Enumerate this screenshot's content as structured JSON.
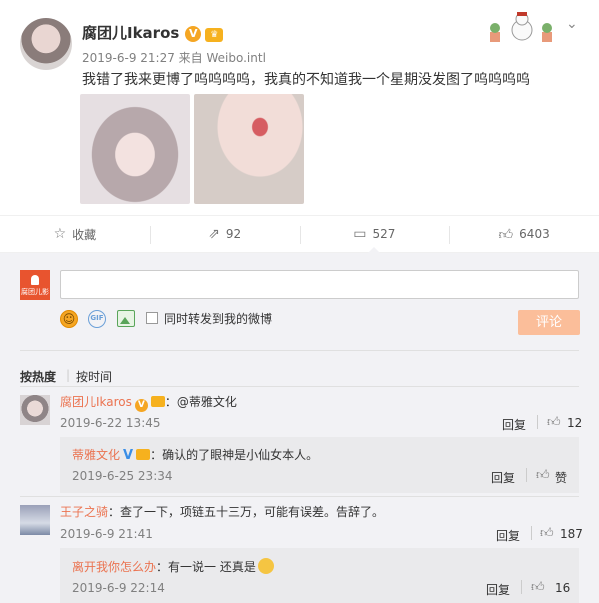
{
  "post": {
    "author": "腐团儿Ikaros",
    "v_badge": "V",
    "meta": "2019-6-9 21:27 来自 Weibo.intl",
    "text": "我错了我来更博了呜呜呜呜，我真的不知道我一个星期没发图了呜呜呜呜"
  },
  "actions": [
    {
      "label": "收藏",
      "icon": "star-icon"
    },
    {
      "label": "92",
      "icon": "share-icon"
    },
    {
      "label": "527",
      "icon": "comment-icon"
    },
    {
      "label": "6403",
      "icon": "like-icon"
    }
  ],
  "composer": {
    "avatar_text": "腐团儿影",
    "input_value": "",
    "repost_label": "同时转发到我的微博",
    "submit_label": "评论"
  },
  "sort": {
    "hot": "按热度",
    "separator": "|",
    "time": "按时间"
  },
  "comments": [
    {
      "name": "腐团儿Ikaros",
      "text": "：@蒂雅文化",
      "time": "2019-6-22 13:45",
      "reply_label": "回复",
      "likes": "12",
      "reply": {
        "name": "蒂雅文化",
        "text": "：确认的了眼神是小仙女本人。",
        "time": "2019-6-25 23:34",
        "reply_label": "回复",
        "likes": "赞"
      }
    },
    {
      "name": "王子之骑",
      "text": "：查了一下，项链五十三万，可能有误差。告辞了。",
      "time": "2019-6-9 21:41",
      "reply_label": "回复",
      "likes": "187",
      "reply": {
        "name": "离开我你怎么办",
        "text": "：有一说一 还真是",
        "time": "2019-6-9 22:14",
        "reply_label": "回复",
        "likes": "16"
      }
    }
  ],
  "colors": {
    "accent": "#eb7350",
    "badge": "#f5a623",
    "submit_disabled": "#fbbe9a"
  }
}
